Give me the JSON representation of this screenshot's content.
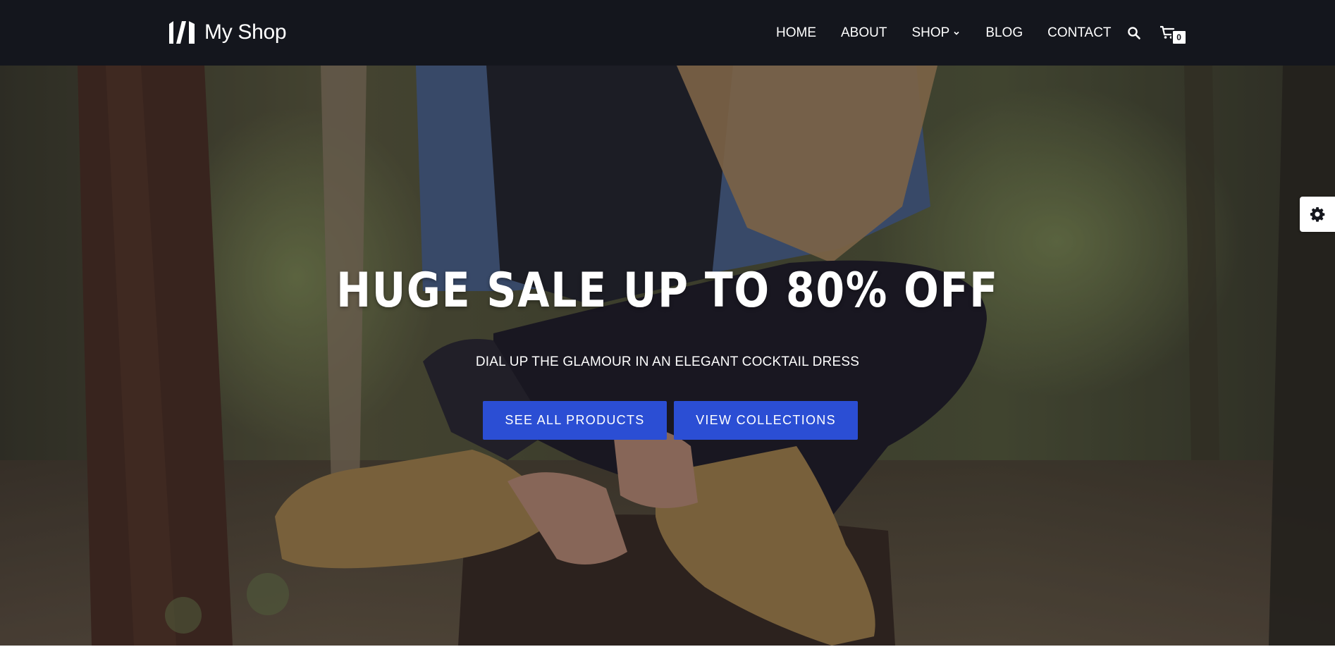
{
  "header": {
    "logo_text": "My Shop",
    "logo_icon": "shop-logo-icon",
    "nav": [
      {
        "label": "HOME"
      },
      {
        "label": "ABOUT"
      },
      {
        "label": "SHOP",
        "has_dropdown": true
      },
      {
        "label": "BLOG"
      },
      {
        "label": "CONTACT"
      }
    ],
    "search_icon": "search-icon",
    "cart_icon": "cart-icon",
    "cart_count": "0"
  },
  "hero": {
    "title": "HUGE SALE UP TO 80% OFF",
    "subtitle": "DIAL UP THE GLAMOUR IN AN ELEGANT COCKTAIL DRESS",
    "buttons": {
      "primary": "SEE ALL PRODUCTS",
      "secondary": "VIEW COLLECTIONS"
    }
  },
  "settings": {
    "icon": "gear-icon"
  },
  "colors": {
    "header_bg": "#14161d",
    "accent": "#2b4ed4",
    "text": "#ffffff"
  }
}
